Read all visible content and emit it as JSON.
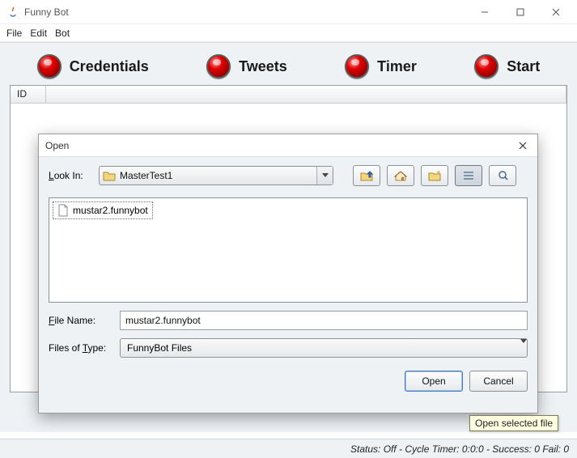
{
  "window": {
    "title": "Funny Bot"
  },
  "menu": {
    "file": "File",
    "edit": "Edit",
    "bot": "Bot"
  },
  "tabs": {
    "credentials": "Credentials",
    "tweets": "Tweets",
    "timer": "Timer",
    "start": "Start"
  },
  "table": {
    "col_id": "ID"
  },
  "status": {
    "text": "Status: Off - Cycle Timer: 0:0:0 - Success: 0 Fail: 0"
  },
  "dialog": {
    "title": "Open",
    "look_in_label": "Look In:",
    "look_in_value": "MasterTest1",
    "file_list": [
      "mustar2.funnybot"
    ],
    "file_name_label": "File Name:",
    "file_name_value": "mustar2.funnybot",
    "files_of_type_label": "Files of Type:",
    "files_of_type_value": "FunnyBot Files",
    "open_btn": "Open",
    "cancel_btn": "Cancel"
  },
  "tooltip": {
    "text": "Open selected file"
  }
}
